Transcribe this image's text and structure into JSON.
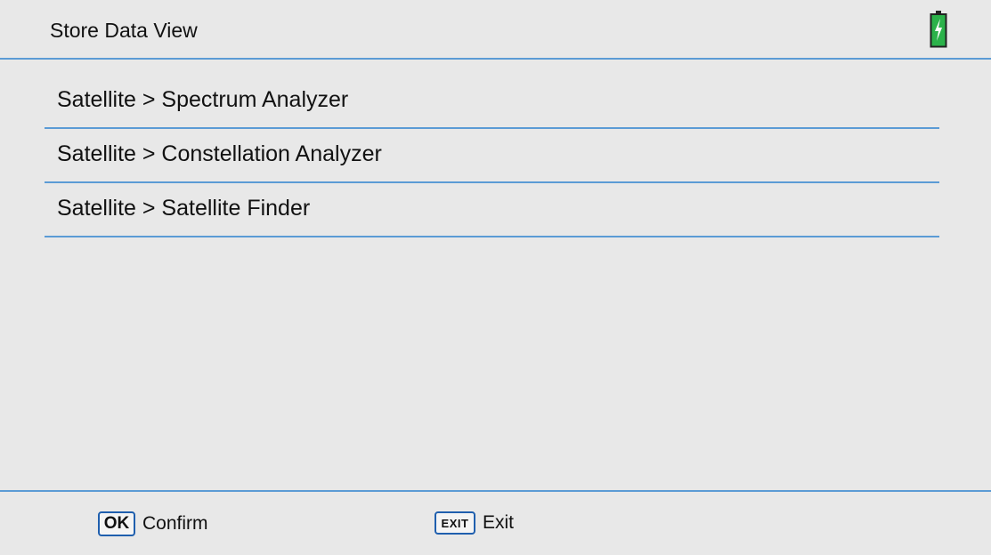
{
  "header": {
    "title": "Store Data View",
    "battery_icon": "battery-charging-icon",
    "accent_color": "#5b9bd5"
  },
  "menu": {
    "items": [
      {
        "label": "Satellite > Spectrum Analyzer"
      },
      {
        "label": "Satellite > Constellation Analyzer"
      },
      {
        "label": "Satellite > Satellite Finder"
      }
    ]
  },
  "footer": {
    "confirm": {
      "key": "OK",
      "label": "Confirm"
    },
    "exit": {
      "key": "EXIT",
      "label": "Exit"
    }
  }
}
